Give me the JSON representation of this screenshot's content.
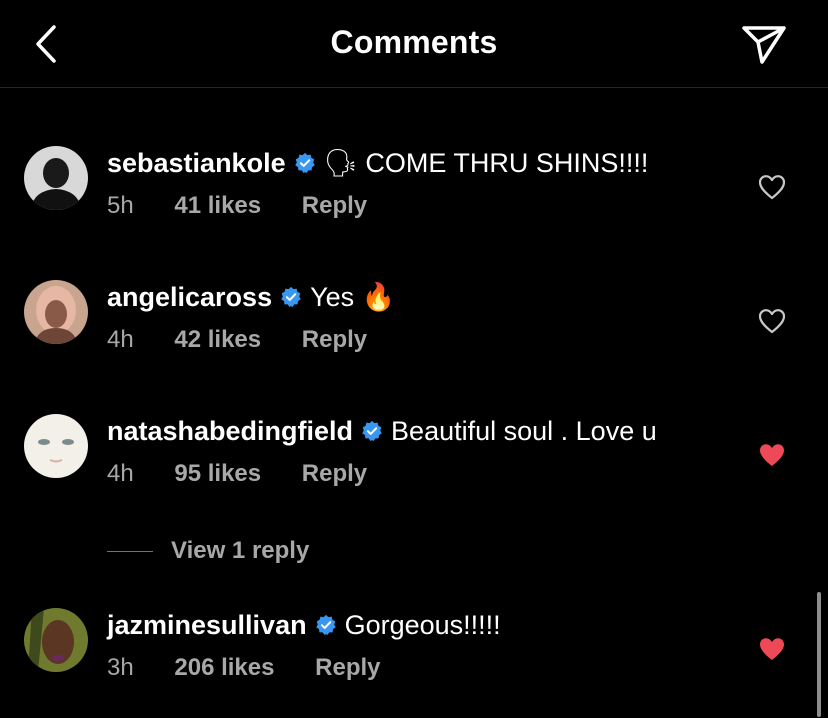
{
  "header": {
    "title": "Comments"
  },
  "icons": {
    "back": "chevron-left-icon",
    "send": "paper-plane-icon",
    "verified": "verified-badge-icon",
    "heart": "heart-icon"
  },
  "colors": {
    "background": "#000000",
    "verified": "#3897f0",
    "liked_heart": "#ed4956",
    "secondary_text": "#a8a8a8"
  },
  "comments": [
    {
      "username": "sebastiankole",
      "verified": true,
      "text": "🗣 COME THRU SHINS!!!!",
      "time": "5h",
      "likes": "41 likes",
      "reply_label": "Reply",
      "liked": false
    },
    {
      "username": "angelicaross",
      "verified": true,
      "text": "Yes 🔥",
      "time": "4h",
      "likes": "42 likes",
      "reply_label": "Reply",
      "liked": false
    },
    {
      "username": "natashabedingfield",
      "verified": true,
      "text": "Beautiful soul . Love u",
      "time": "4h",
      "likes": "95 likes",
      "reply_label": "Reply",
      "liked": true,
      "view_replies_label": "View 1 reply"
    },
    {
      "username": "jazminesullivan",
      "verified": true,
      "text": "Gorgeous!!!!!",
      "time": "3h",
      "likes": "206 likes",
      "reply_label": "Reply",
      "liked": true
    }
  ]
}
